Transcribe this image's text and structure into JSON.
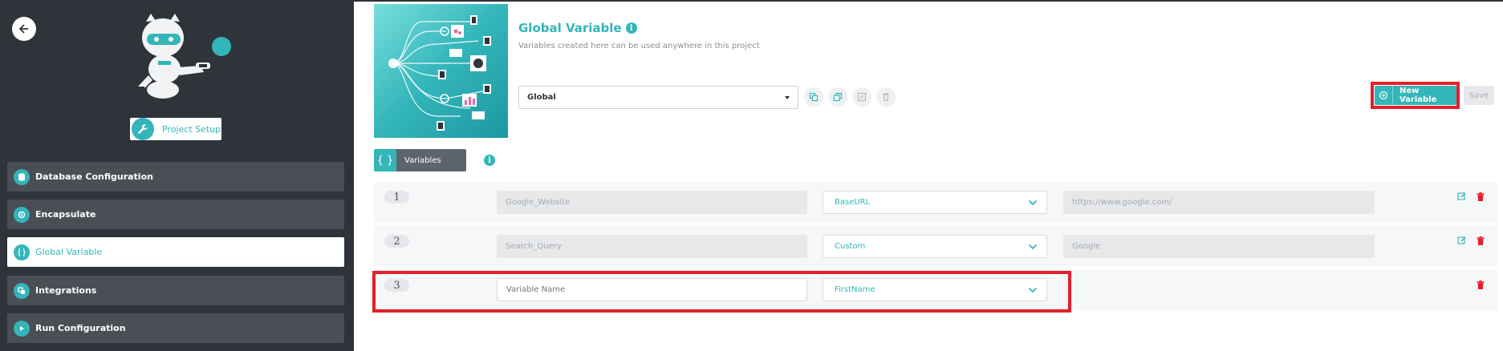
{
  "sidebar": {
    "project_setup_label": "Project Setup",
    "items": [
      {
        "label": "Database Configuration",
        "icon": "database-icon"
      },
      {
        "label": "Encapsulate",
        "icon": "encapsulate-icon"
      },
      {
        "label": "Global Variable",
        "icon": "braces-icon",
        "active": true
      },
      {
        "label": "Integrations",
        "icon": "integrations-icon"
      },
      {
        "label": "Run Configuration",
        "icon": "play-icon"
      }
    ]
  },
  "header": {
    "title": "Global Variable",
    "subtitle": "Variables created here can be used anywhere in this project",
    "scope_select": "Global",
    "new_variable_label": "New Variable",
    "save_label": "Save"
  },
  "tab": {
    "label": "Variables",
    "icon_glyph": "{ }"
  },
  "variables": [
    {
      "num": "1",
      "name": "Google_Website",
      "type": "BaseURL",
      "value": "https://www.google.com/"
    },
    {
      "num": "2",
      "name": "Search_Query",
      "type": "Custom",
      "value": "Google"
    },
    {
      "num": "3",
      "name_placeholder": "Variable Name",
      "type": "FirstName"
    }
  ],
  "colors": {
    "accent": "#33b5b9",
    "sidebar_bg": "#2f333a",
    "highlight": "#e3202b",
    "delete": "#e3202b"
  }
}
